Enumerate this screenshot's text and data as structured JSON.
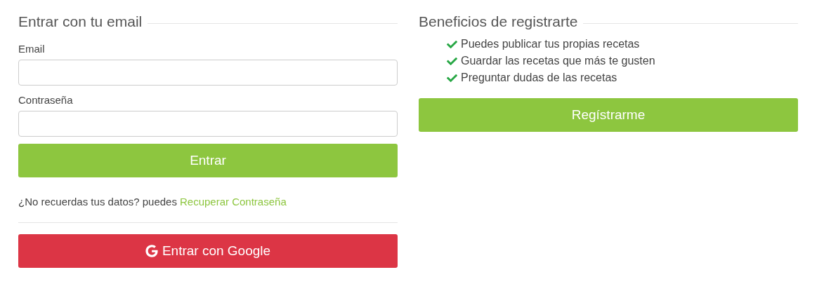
{
  "login": {
    "title": "Entrar con tu email",
    "fields": [
      {
        "label": "Email"
      },
      {
        "label": "Contraseña"
      }
    ],
    "submit_button": "Entrar",
    "recover": {
      "text": "¿No recuerdas tus datos? puedes",
      "link": "Recuperar Contraseña"
    },
    "google_button": "Entrar con Google"
  },
  "benefits": {
    "title": "Beneficios de registrarte",
    "items": [
      "Puedes publicar tus propias recetas",
      "Guardar las recetas que más te gusten",
      "Preguntar dudas de las recetas"
    ],
    "register_button": "Regístrarme"
  }
}
